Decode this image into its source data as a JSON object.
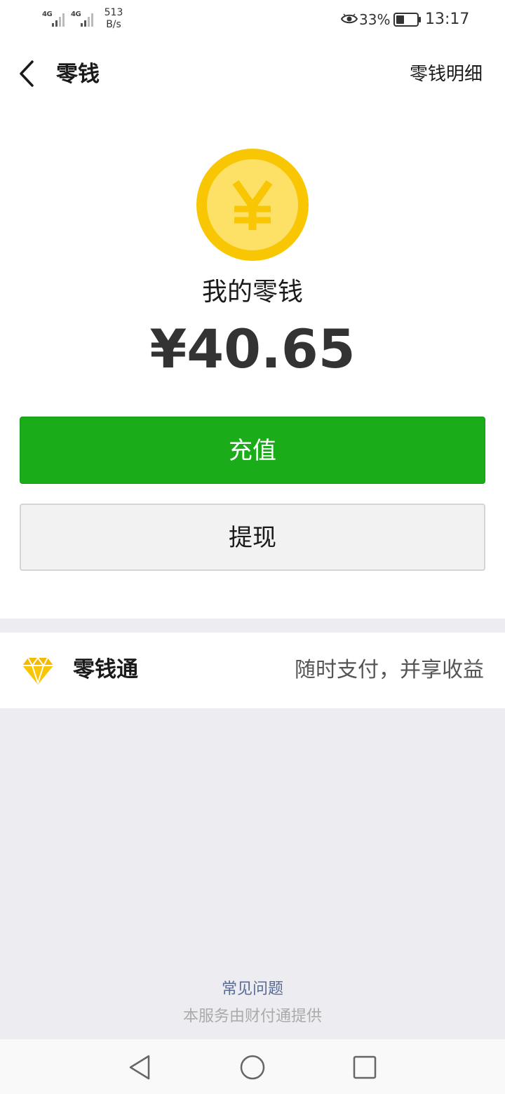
{
  "status_bar": {
    "network_1": "4G",
    "network_2": "4G",
    "speed_value": "513",
    "speed_unit": "B/s",
    "battery_percent": "33%",
    "time": "13:17"
  },
  "nav": {
    "title": "零钱",
    "action": "零钱明细"
  },
  "balance": {
    "label": "我的零钱",
    "amount": "¥40.65"
  },
  "buttons": {
    "recharge": "充值",
    "withdraw": "提现"
  },
  "lingqiantong": {
    "title": "零钱通",
    "description": "随时支付，并享收益"
  },
  "footer": {
    "faq": "常见问题",
    "provider": "本服务由财付通提供"
  },
  "icons": {
    "back": "chevron-left-icon",
    "coin": "yuan-coin-icon",
    "diamond": "diamond-icon",
    "eye": "eye-icon",
    "battery": "battery-icon"
  },
  "colors": {
    "primary_green": "#1aad19",
    "coin_yellow": "#f8c602",
    "link_blue": "#576b95"
  }
}
